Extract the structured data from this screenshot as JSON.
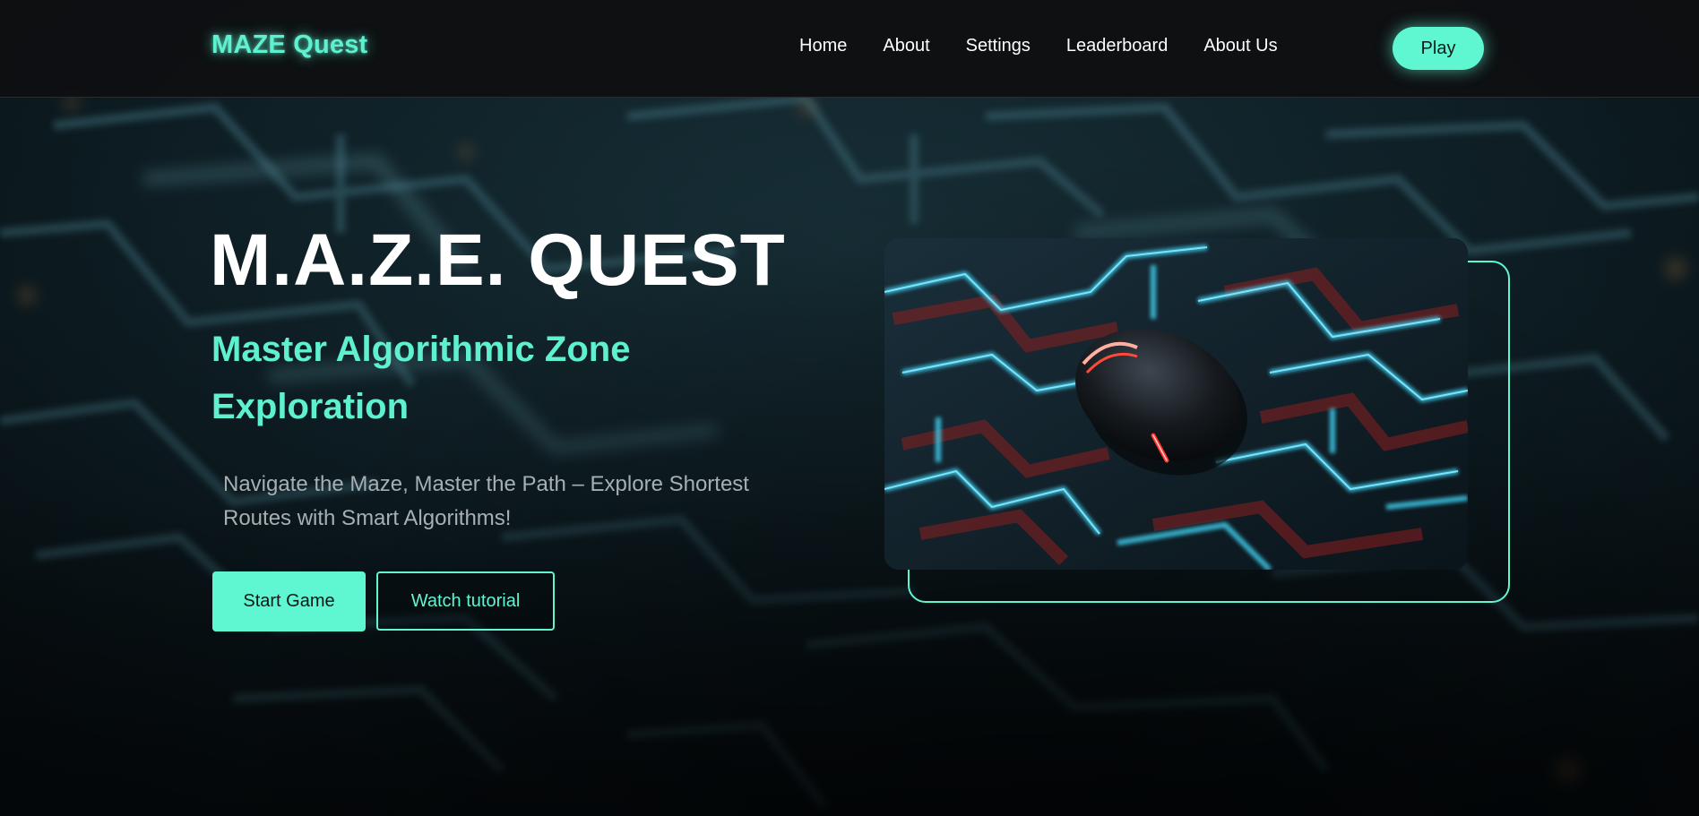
{
  "brand": "MAZE Quest",
  "nav": {
    "items": [
      "Home",
      "About",
      "Settings",
      "Leaderboard",
      "About Us"
    ],
    "play_label": "Play"
  },
  "hero": {
    "title": "M.A.Z.E. QUEST",
    "subtitle": "Master Algorithmic Zone Exploration",
    "description": "Navigate the Maze, Master the Path – Explore Shortest Routes with Smart Algorithms!",
    "start_label": "Start Game",
    "watch_label": "Watch tutorial"
  },
  "colors": {
    "accent": "#5ff6d2",
    "background": "#070b0e",
    "nav_bg": "#0e1012",
    "maze_glow": "#3ec9e8"
  }
}
